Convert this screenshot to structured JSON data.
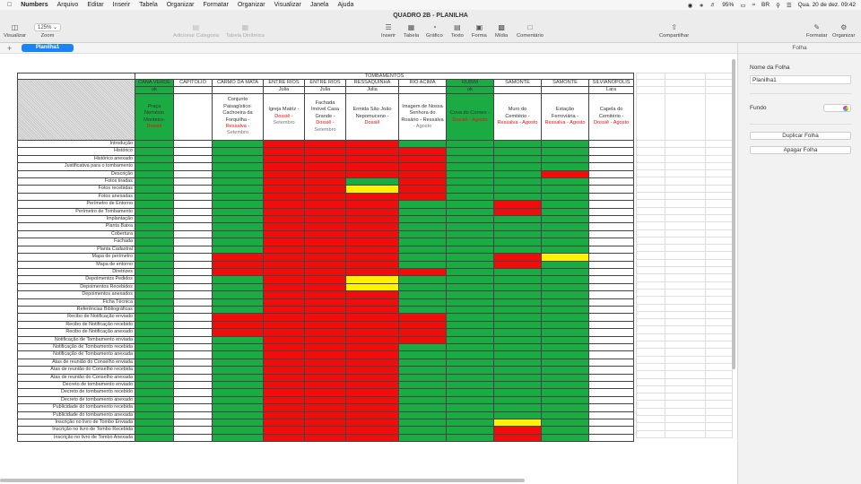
{
  "menubar": {
    "app": "Numbers",
    "items": [
      "Arquivo",
      "Editar",
      "Inserir",
      "Tabela",
      "Organizar",
      "Formatar",
      "Organizar",
      "Visualizar",
      "Janela",
      "Ajuda"
    ],
    "battery": "95%",
    "input_source": "BR",
    "datetime": "Qua. 20 de dez.  09:42"
  },
  "window": {
    "title": "QUADRO 2B - PLANILHA"
  },
  "toolbar": {
    "view": "Visualizar",
    "zoom_value": "125%",
    "zoom": "Zoom",
    "add_category": "Adicionar Categoria",
    "pivot_table": "Tabela Dinâmica",
    "insert": "Inserir",
    "table": "Tabela",
    "chart": "Gráfico",
    "text": "Texto",
    "shape": "Forma",
    "media": "Mídia",
    "comment": "Comentário",
    "share": "Compartilhar",
    "format": "Formatar",
    "organize": "Organizar"
  },
  "tabs": {
    "add": "+",
    "sheet": "Planilha1"
  },
  "sheet": {
    "title": "TOMBAMENTOS",
    "columns": [
      {
        "name": "CANA VERDE",
        "sub": "ok",
        "desc": [
          [
            "Praça",
            ""
          ],
          [
            "Nemésio",
            ""
          ],
          [
            "Monteiro-",
            ""
          ],
          [
            "Dossiê",
            "red"
          ]
        ]
      },
      {
        "name": "CAPITÓLIO",
        "sub": "",
        "desc": []
      },
      {
        "name": "CARMO DA MATA",
        "sub": "",
        "desc": [
          [
            "Conjunto",
            ""
          ],
          [
            "Paisagístico:",
            ""
          ],
          [
            "Cachoeira da",
            ""
          ],
          [
            "Forquilha -",
            ""
          ],
          [
            "Ressalva -",
            "red"
          ],
          [
            "Setembro",
            "gry"
          ]
        ]
      },
      {
        "name": "ENTRE RIOS",
        "sub": "Julia",
        "desc": [
          [
            "Igreja Matriz -",
            ""
          ],
          [
            "Dossiê -",
            "red"
          ],
          [
            "Setembro",
            "gry"
          ]
        ]
      },
      {
        "name": "ENTRE RIOS",
        "sub": "Julia",
        "desc": [
          [
            "Fachada",
            ""
          ],
          [
            "Imóvel Casa",
            ""
          ],
          [
            "Grande -",
            ""
          ],
          [
            "Dossiê -",
            "red"
          ],
          [
            "Setembro",
            "gry"
          ]
        ]
      },
      {
        "name": "RESSAQUINHA",
        "sub": "Julia",
        "desc": [
          [
            "Ermida São João",
            ""
          ],
          [
            "Nepomuceno -",
            ""
          ],
          [
            "Dossiê",
            "red"
          ]
        ]
      },
      {
        "name": "RIO ACIMA",
        "sub": "",
        "desc": [
          [
            "Imagem de Nossa",
            ""
          ],
          [
            "Senhora do",
            ""
          ],
          [
            "Rosário - Ressalva",
            ""
          ],
          [
            "- Agosto",
            "gry"
          ]
        ]
      },
      {
        "name": "RUBIM",
        "sub": "ok",
        "desc": [
          [
            "Cova do Corneo -",
            ""
          ],
          [
            "Dossiê - Agosto",
            "red"
          ]
        ]
      },
      {
        "name": "SAMONTE",
        "sub": "",
        "desc": [
          [
            "Muro do",
            ""
          ],
          [
            "Cemitério -",
            ""
          ],
          [
            "Ressalva - Agosto",
            "red"
          ]
        ]
      },
      {
        "name": "SAMONTE",
        "sub": "",
        "desc": [
          [
            "Estação",
            ""
          ],
          [
            "Ferroviária -",
            ""
          ],
          [
            "Ressalva - Agosto",
            "red"
          ]
        ]
      },
      {
        "name": "SILVIANÓPOLIS",
        "sub": "Lara",
        "desc": [
          [
            "Capela do",
            ""
          ],
          [
            "Cemitério -",
            ""
          ],
          [
            "Dossiê - Agosto",
            "red"
          ]
        ]
      }
    ],
    "rows": [
      {
        "label": "Introdução",
        "cells": "GWGRRRGGGGW"
      },
      {
        "label": "Histórico",
        "cells": "GWGRRRRGGGW"
      },
      {
        "label": "Histórico anexado",
        "cells": "GWGRRRRGGGW"
      },
      {
        "label": "Justificativa para o tombamento",
        "cells": "GWGRRRRGGGW"
      },
      {
        "label": "Descrição",
        "cells": "GWGRRRRGGRW"
      },
      {
        "label": "Fotos tiradas",
        "cells": "GWGRRGRGGGW"
      },
      {
        "label": "Fotos recebidas",
        "cells": "GWGRRYRGGGW"
      },
      {
        "label": "Fotos anexadas",
        "cells": "GWGRRRRGGGW"
      },
      {
        "label": "Perímetro de Entorno",
        "cells": "GWGRRRGGRGW"
      },
      {
        "label": "Perímetro de Tombamento",
        "cells": "GWGRRRGGRGW"
      },
      {
        "label": "Implantação",
        "cells": "GWGRRRGGGGW"
      },
      {
        "label": "Planta Baixa",
        "cells": "GWGRRRGGGGW"
      },
      {
        "label": "Cobertura",
        "cells": "GWGRRRGGGGW"
      },
      {
        "label": "Fachada",
        "cells": "GWGRRRGGGGW"
      },
      {
        "label": "Planta Cadastral",
        "cells": "GWGRRRGGGGW"
      },
      {
        "label": "Mapa de perímetro",
        "cells": "GWRRRRGGRYW"
      },
      {
        "label": "Mapa de entorno",
        "cells": "GWRRRRGGRGW"
      },
      {
        "label": "Diretrizes",
        "cells": "GWRRRRRGGGW"
      },
      {
        "label": "Depoimentos Pedidos",
        "cells": "GWGRRYGGGGW"
      },
      {
        "label": "Depoimentos Recebidos",
        "cells": "GWGRRYGGGGW"
      },
      {
        "label": "Depoimentos anexados",
        "cells": "GWGRRRGGGGW"
      },
      {
        "label": "Ficha Técnica",
        "cells": "GWGRRRGGGGW"
      },
      {
        "label": "Referências Bibliográficas",
        "cells": "GWGRRRGGGGW"
      },
      {
        "label": "Recibo de Notificação enviado",
        "cells": "GWRRRRRGGGW"
      },
      {
        "label": "Recibo de Notificação recebido",
        "cells": "GWRRRRRGGGW"
      },
      {
        "label": "Recibo de Notificação anexado",
        "cells": "GWRRRRRGGGW"
      },
      {
        "label": "Notificação de Tombamento enviada",
        "cells": "GWGRRRRGGGW"
      },
      {
        "label": "Notificação de Tombamento recebida",
        "cells": "GWGRRRGGGGW"
      },
      {
        "label": "Notificação de Tombamento anexada",
        "cells": "GWGRRRGGGGW"
      },
      {
        "label": "Atas de reunião do Conselho enviada",
        "cells": "GWGRRRGGGGW"
      },
      {
        "label": "Atas de reunião do Conselho recebida",
        "cells": "GWGRRRGGGGW"
      },
      {
        "label": "Atas de reunião do Conselho anexada",
        "cells": "GWGRRRGGGGW"
      },
      {
        "label": "Decreto de tombamento enviado",
        "cells": "GWGRRRGGGGW"
      },
      {
        "label": "Decreto de tombamento recebido",
        "cells": "GWGRRRGGGGW"
      },
      {
        "label": "Decreto de tombamento anexado",
        "cells": "GWGRRRGGGGW"
      },
      {
        "label": "Publicidade do tombamento recebida",
        "cells": "GWGRRRGGGGW"
      },
      {
        "label": "Publicidade do tombamento anexada",
        "cells": "GWGRRRGGGGW"
      },
      {
        "label": "Inscrição no livro de Tombo Enviada",
        "cells": "GWGRRRGGYGW"
      },
      {
        "label": "Inscrição no livro de Tombo Recebida",
        "cells": "GWGRRRGGRGW"
      },
      {
        "label": "Inscrição no livro de Tombo Anexada",
        "cells": "GWGRRRGGRGW"
      }
    ],
    "header_green_cols": [
      0,
      7
    ],
    "colors": {
      "green": "#1aab43",
      "red": "#f20d0d",
      "yellow": "#fff200"
    }
  },
  "sidebar": {
    "title": "Folha",
    "sheet_name_label": "Nome da Folha",
    "sheet_name_value": "Planilha1",
    "background_label": "Fundo",
    "duplicate": "Duplicar Folha",
    "delete": "Apagar Folha"
  }
}
